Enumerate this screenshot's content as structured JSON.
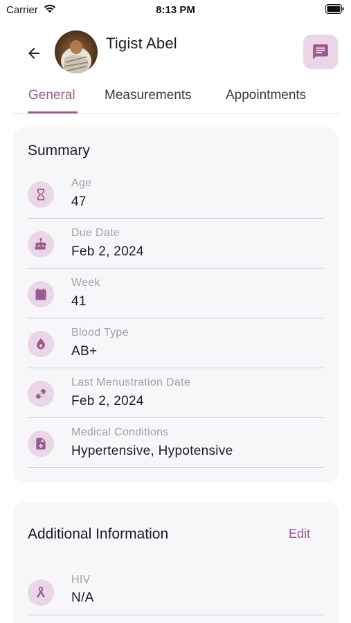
{
  "status_bar": {
    "carrier": "Carrier",
    "time": "8:13 PM"
  },
  "header": {
    "patient_name": "Tigist Abel",
    "back_icon": "arrow-back-icon",
    "chat_icon": "chat-message-icon"
  },
  "tabs": [
    {
      "label": "General",
      "active": true
    },
    {
      "label": "Measurements",
      "active": false
    },
    {
      "label": "Appointments",
      "active": false
    }
  ],
  "summary": {
    "title": "Summary",
    "rows": [
      {
        "label": "Age",
        "value": "47",
        "icon": "hourglass-icon"
      },
      {
        "label": "Due Date",
        "value": "Feb 2, 2024",
        "icon": "cake-icon"
      },
      {
        "label": "Week",
        "value": "41",
        "icon": "calendar-icon"
      },
      {
        "label": "Blood Type",
        "value": "AB+",
        "icon": "blood-drop-icon"
      },
      {
        "label": "Last Menustration Date",
        "value": "Feb 2, 2024",
        "icon": "bandage-icon"
      },
      {
        "label": "Medical Conditions",
        "value": "Hypertensive, Hypotensive",
        "icon": "medical-file-icon"
      }
    ]
  },
  "additional": {
    "title": "Additional Information",
    "edit_label": "Edit",
    "rows": [
      {
        "label": "HIV",
        "value": "N/A",
        "icon": "awareness-ribbon-icon"
      }
    ]
  },
  "colors": {
    "accent": "#9a5a8e",
    "icon_bg": "#ead6e6",
    "card_bg": "#f7f6f9"
  }
}
